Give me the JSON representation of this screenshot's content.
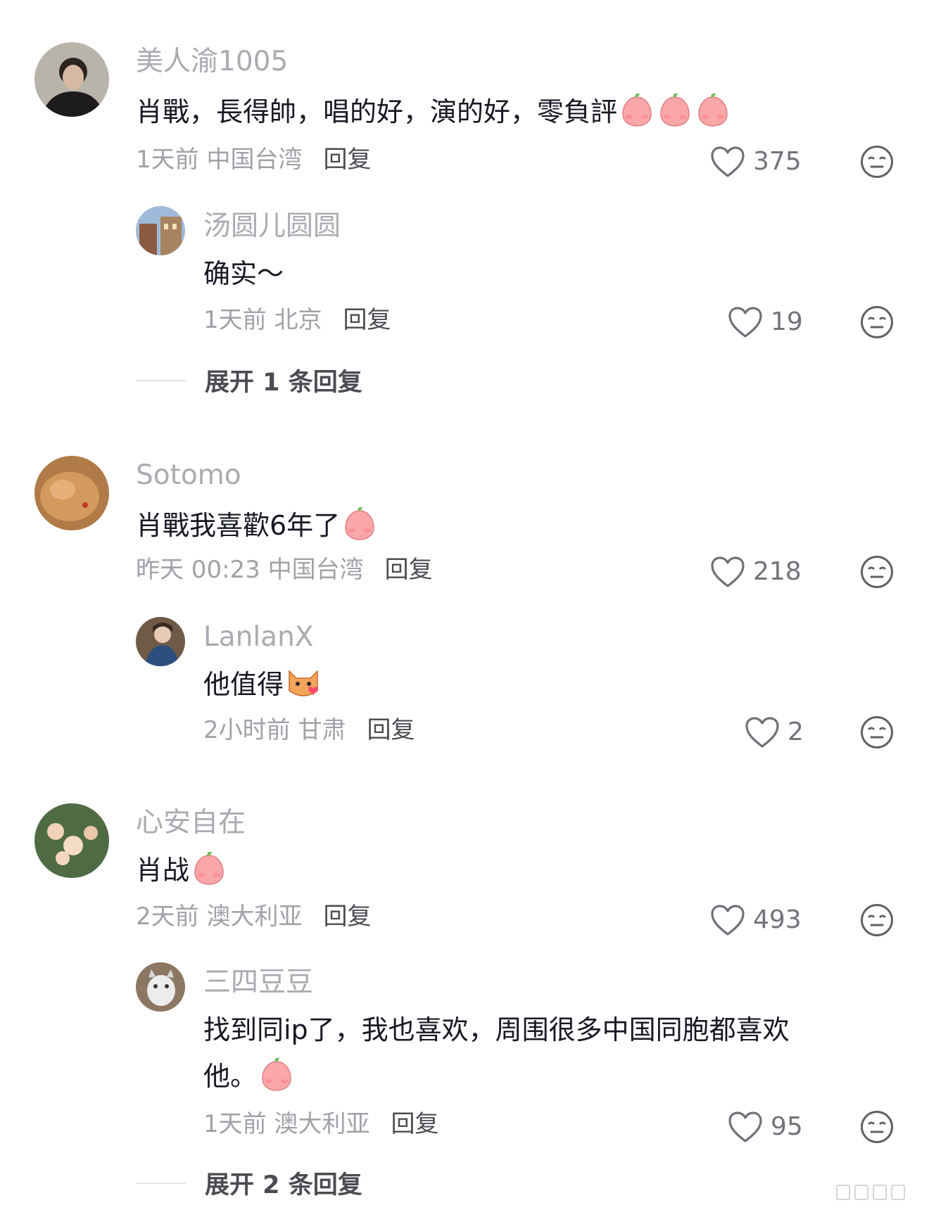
{
  "comments": [
    {
      "user": "美人渝1005",
      "text": "肖戰，長得帥，唱的好，演的好，零負評",
      "emoji": "cheering-emoji",
      "emoji_count": 3,
      "time": "1天前",
      "location": "中国台湾",
      "reply_label": "回复",
      "likes": "375",
      "replies": [
        {
          "user": "汤圆儿圆圆",
          "text": "确实～",
          "time": "1天前",
          "location": "北京",
          "reply_label": "回复",
          "likes": "19"
        }
      ],
      "expand_label": "展开 1 条回复"
    },
    {
      "user": "Sotomo",
      "text": "肖戰我喜歡6年了",
      "emoji": "smile-emoji",
      "time": "昨天 00:23",
      "location": "中国台湾",
      "reply_label": "回复",
      "likes": "218",
      "replies": [
        {
          "user": "LanlanX",
          "text": "他值得",
          "emoji": "cat-heart-emoji",
          "time": "2小时前",
          "location": "甘肃",
          "reply_label": "回复",
          "likes": "2"
        }
      ]
    },
    {
      "user": "心安自在",
      "text": "肖战",
      "emoji": "kiss-emoji",
      "time": "2天前",
      "location": "澳大利亚",
      "reply_label": "回复",
      "likes": "493",
      "replies": [
        {
          "user": "三四豆豆",
          "text_line1": "找到同ip了，我也喜欢，周围很多中国同胞都喜欢",
          "text_line2": "他。",
          "emoji": "kiss-emoji",
          "time": "1天前",
          "location": "澳大利亚",
          "reply_label": "回复",
          "likes": "95"
        }
      ],
      "expand_label": "展开 2 条回复"
    }
  ],
  "colors": {
    "name": "#a9abb1",
    "text": "#161823",
    "meta": "#a0a2a8",
    "reply": "#4a4c52",
    "emoji_pink": "#f59aa0"
  }
}
